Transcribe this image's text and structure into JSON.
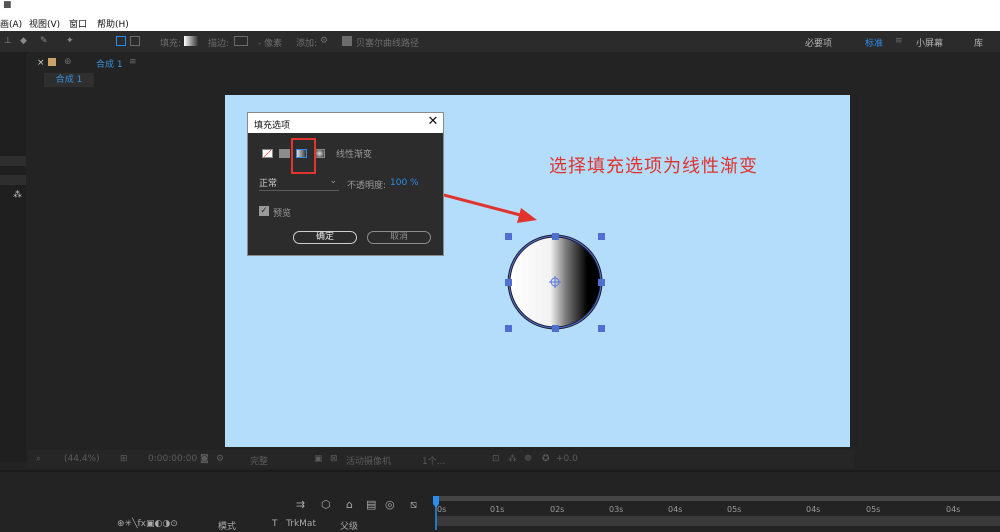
{
  "menubar": {
    "dot": "■",
    "items": [
      "画(A)",
      "视图(V)",
      "窗口",
      "帮助(H)"
    ]
  },
  "toolbar": {
    "fill_label": "填充:",
    "stroke_label": "描边:",
    "stroke_width": "- 像素",
    "add_label": "添加:",
    "bezier_label": "贝塞尔曲线路径",
    "workspaces": [
      "必要项",
      "标准",
      "小屏幕",
      "库"
    ],
    "active_workspace": "标准"
  },
  "comp_panel": {
    "header_title": "合成 1",
    "tab_label": "合成 1"
  },
  "annotation": {
    "text": "选择填充选项为线性渐变"
  },
  "dialog": {
    "title": "填充选项",
    "fill_type_label": "线性渐变",
    "blend_mode": "正常",
    "opacity_label": "不透明度:",
    "opacity_value": "100 %",
    "preview_label": "预览",
    "ok_label": "确定",
    "cancel_label": "取消"
  },
  "viewer_bar": {
    "zoom": "(44.4%)",
    "timecode": "0:00:00:00",
    "resolution": "完整",
    "camera": "活动摄像机",
    "views": "1个...",
    "exposure": "+0.0"
  },
  "timeline": {
    "ticks": [
      "0s",
      "01s",
      "02s",
      "03s",
      "04s",
      "05s",
      "04s",
      "05s",
      "04s"
    ],
    "mode_label": "模式",
    "trkmat_label": "T   TrkMat",
    "parent_label": "父级"
  },
  "colors": {
    "accent": "#2d8ceb",
    "annotation_red": "#e0332e",
    "canvas": "#b4dcfb",
    "handles": "#4f6fd1"
  }
}
